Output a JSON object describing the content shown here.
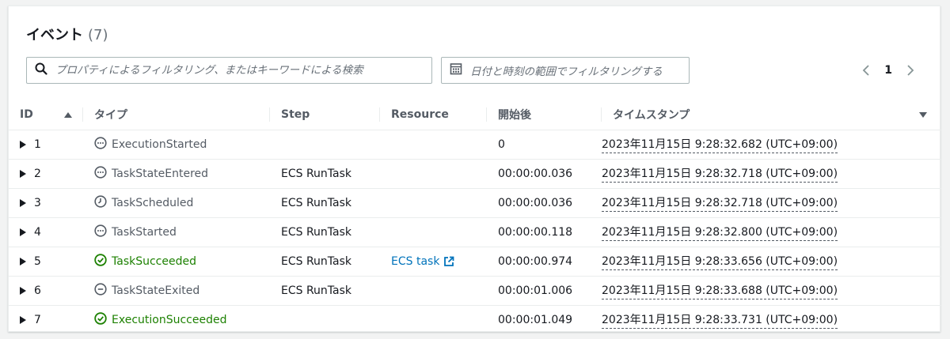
{
  "panel": {
    "title": "イベント",
    "count": "(7)"
  },
  "search": {
    "placeholder": "プロパティによるフィルタリング、またはキーワードによる検索",
    "value": ""
  },
  "date_filter": {
    "label": "日付と時刻の範囲でフィルタリングする"
  },
  "pagination": {
    "current_page": "1"
  },
  "table": {
    "headers": {
      "id": "ID",
      "type": "タイプ",
      "step": "Step",
      "resource": "Resource",
      "elapsed": "開始後",
      "timestamp": "タイムスタンプ"
    },
    "rows": [
      {
        "id": "1",
        "type": "ExecutionStarted",
        "icon": "ellipsis-circle-icon",
        "status": "neutral",
        "step": "",
        "resource": "",
        "elapsed": "0",
        "timestamp": "2023年11月15日 9:28:32.682 (UTC+09:00)"
      },
      {
        "id": "2",
        "type": "TaskStateEntered",
        "icon": "ellipsis-circle-icon",
        "status": "neutral",
        "step": "ECS RunTask",
        "resource": "",
        "elapsed": "00:00:00.036",
        "timestamp": "2023年11月15日 9:28:32.718 (UTC+09:00)"
      },
      {
        "id": "3",
        "type": "TaskScheduled",
        "icon": "clock-icon",
        "status": "neutral",
        "step": "ECS RunTask",
        "resource": "",
        "elapsed": "00:00:00.036",
        "timestamp": "2023年11月15日 9:28:32.718 (UTC+09:00)"
      },
      {
        "id": "4",
        "type": "TaskStarted",
        "icon": "ellipsis-circle-icon",
        "status": "neutral",
        "step": "ECS RunTask",
        "resource": "",
        "elapsed": "00:00:00.118",
        "timestamp": "2023年11月15日 9:28:32.800 (UTC+09:00)"
      },
      {
        "id": "5",
        "type": "TaskSucceeded",
        "icon": "check-circle-icon",
        "status": "success",
        "step": "ECS RunTask",
        "resource": "ECS task",
        "elapsed": "00:00:00.974",
        "timestamp": "2023年11月15日 9:28:33.656 (UTC+09:00)"
      },
      {
        "id": "6",
        "type": "TaskStateExited",
        "icon": "minus-circle-icon",
        "status": "neutral",
        "step": "ECS RunTask",
        "resource": "",
        "elapsed": "00:00:01.006",
        "timestamp": "2023年11月15日 9:28:33.688 (UTC+09:00)"
      },
      {
        "id": "7",
        "type": "ExecutionSucceeded",
        "icon": "check-circle-icon",
        "status": "success",
        "step": "",
        "resource": "",
        "elapsed": "00:00:01.049",
        "timestamp": "2023年11月15日 9:28:33.731 (UTC+09:00)"
      }
    ]
  },
  "colors": {
    "success": "#1d8102",
    "link": "#0073bb",
    "neutral": "#545b64"
  }
}
